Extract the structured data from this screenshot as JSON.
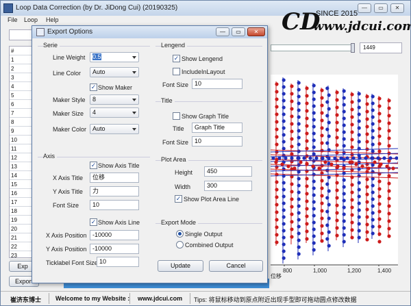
{
  "app": {
    "title": "Loop Data Correction (by Dr. JiDong Cui) (20190325)",
    "minimize": "—",
    "maximize": "▭",
    "close": "✕",
    "menu": [
      "File",
      "Loop",
      "Help"
    ],
    "logo": {
      "mark": "CD",
      "since": "SINCE 2015",
      "url": "www.jdcui.com"
    },
    "grid": {
      "header": "#",
      "rows": [
        "1",
        "2",
        "3",
        "4",
        "5",
        "6",
        "7",
        "8",
        "9",
        "10",
        "11",
        "12",
        "13",
        "14",
        "15",
        "16",
        "17",
        "18",
        "19",
        "20",
        "21",
        "22",
        "23"
      ]
    },
    "slider_value": "1449",
    "x_ticks": [
      "800",
      "1,000",
      "1,200",
      "1,400"
    ],
    "x_axis_title": "位移",
    "bottom_buttons": [
      "Exp",
      "Export"
    ],
    "status": {
      "author": "崔济东博士",
      "welcome": "Welcome to my Website :",
      "site": "www.jdcui.com",
      "tips": "Tips: 将鼠标移动到原点附近出现手型即可拖动圆点修改数据"
    },
    "colors": {
      "red": "#cc1b1b",
      "blue": "#1f2fb8"
    }
  },
  "dialog": {
    "title": "Export Options",
    "serie": {
      "label": "Serie",
      "line_weight_label": "Line Weight",
      "line_weight_value": "0.5",
      "line_color_label": "Line Color",
      "line_color_value": "Auto",
      "show_maker": "Show Maker",
      "maker_style_label": "Maker Style",
      "maker_style_value": "8",
      "maker_size_label": "Maker Size",
      "maker_size_value": "4",
      "maker_color_label": "Maker Color",
      "maker_color_value": "Auto"
    },
    "axis": {
      "label": "Axis",
      "show_axis_title": "Show Axis Title",
      "x_title_label": "X Axis Title",
      "x_title_value": "位移",
      "y_title_label": "Y Axis Title",
      "y_title_value": "力",
      "font_size_label": "Font Size",
      "font_size_value": "10",
      "show_axis_line": "Show Axis Line",
      "x_pos_label": "X Axis Position",
      "x_pos_value": "-10000",
      "y_pos_label": "Y Axis Position",
      "y_pos_value": "-10000",
      "tick_font_label": "Ticklabel Font Size",
      "tick_font_value": "10"
    },
    "legend": {
      "label": "Lengend",
      "show_legend": "Show Lengend",
      "include_layout": "IncludeInLayout",
      "font_size_label": "Font Size",
      "font_size_value": "10"
    },
    "title_group": {
      "label": "Title",
      "show_graph_title": "Show Graph Title",
      "title_label": "Title",
      "title_value": "Graph Title",
      "font_size_label": "Font Size",
      "font_size_value": "10"
    },
    "plot_area": {
      "label": "Plot Area",
      "height_label": "Height",
      "height_value": "450",
      "width_label": "Width",
      "width_value": "300",
      "show_plot_area_line": "Show Plot Area Line"
    },
    "export_mode": {
      "label": "Export Mode",
      "single": "Single Output",
      "combined": "Combined Output"
    },
    "update": "Update",
    "cancel": "Cancel"
  }
}
